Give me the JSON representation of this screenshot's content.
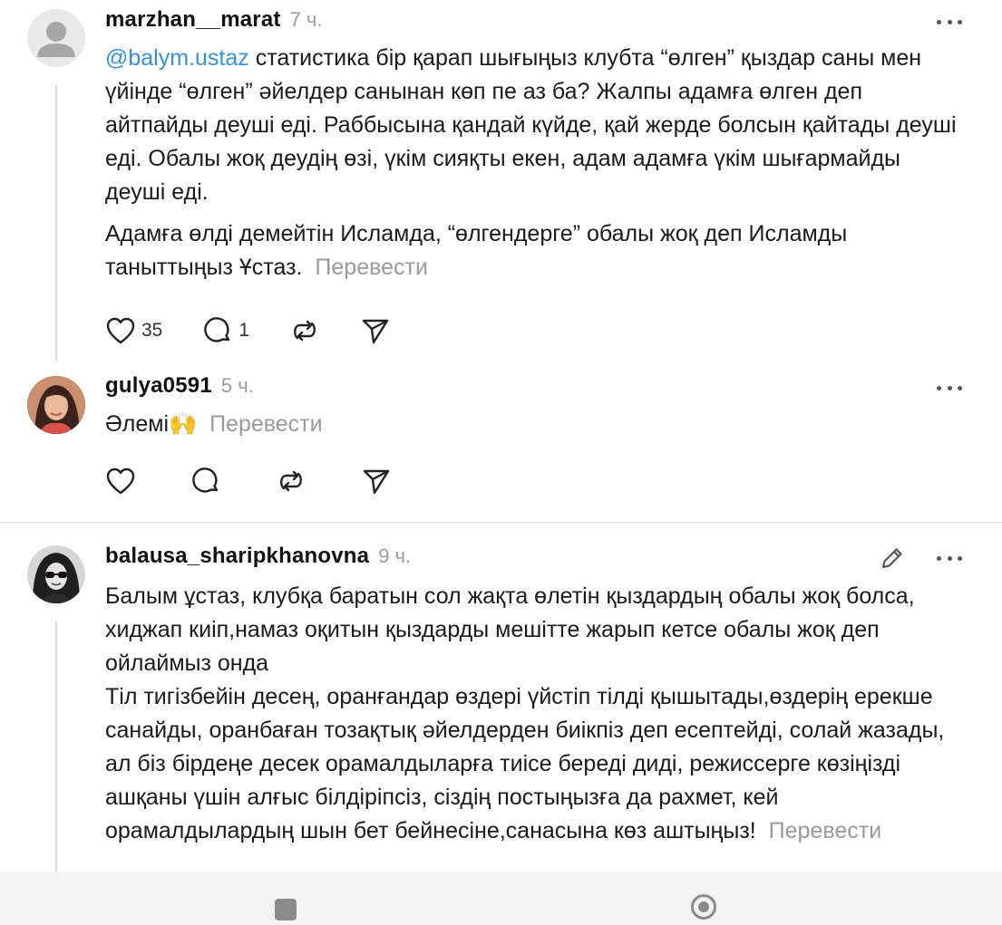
{
  "posts": [
    {
      "username": "marzhan__marat",
      "time": "7 ч.",
      "mention": "@balym.ustaz",
      "paragraph1": " статистика бір қарап шығыңыз клубта “өлген” қыздар саны мен үйінде “өлген” әйелдер санынан көп пе аз ба? Жалпы адамға өлген деп айтпайды деуші еді. Раббысына қандай күйде, қай жерде болсын қайтады деуші еді. Обалы жоқ деудің өзі, үкім сияқты екен, адам адамға үкім шығармайды деуші еді.",
      "paragraph2": "Адамға өлді демейтін Исламда, “өлгендерге” обалы жоқ деп Исламды таныттыңыз Ұстаз.",
      "translate": "Перевести",
      "likes": "35",
      "replies": "1"
    },
    {
      "username": "gulya0591",
      "time": "5 ч.",
      "text": "Әлемі🙌",
      "translate": "Перевести"
    },
    {
      "username": "balausa_sharipkhanovna",
      "time": "9 ч.",
      "line1": "Балым ұстаз, клубқа баратын сол жақта өлетін қыздардың обалы жоқ болса, хиджап киіп,намаз оқитын қыздарды мешітте жарып кетсе обалы жоқ деп ойлаймыз онда",
      "line2": "Тіл тигізбейін десең, оранғандар өздері үйстіп тілді қышытады,өздерің ерекше санайды, оранбаған тозақтық әйелдерден биікпіз деп есептейді, солай жазады, ал біз бірдеңе десек орамалдыларға тиісе береді диді, режиссерге көзіңізді ашқаны үшін алғыс білдіріпсіз, сіздің постыңызға да рахмет, кей орамалдылардың шын бет бейнесіне,санасына көз аштыңыз!",
      "translate": "Перевести"
    }
  ],
  "icons": {
    "like": "heart-icon",
    "reply": "comment-bubble-icon",
    "repost": "repost-icon",
    "share": "send-icon",
    "more": "more-dots-icon",
    "edit": "pencil-icon",
    "nav_recents": "square-nav-icon",
    "nav_home": "circle-nav-icon",
    "nav_back": "back-triangle-icon"
  },
  "colors": {
    "mention": "#3a8fd9",
    "muted": "#9a9a9a",
    "text": "#1a1a1a"
  }
}
